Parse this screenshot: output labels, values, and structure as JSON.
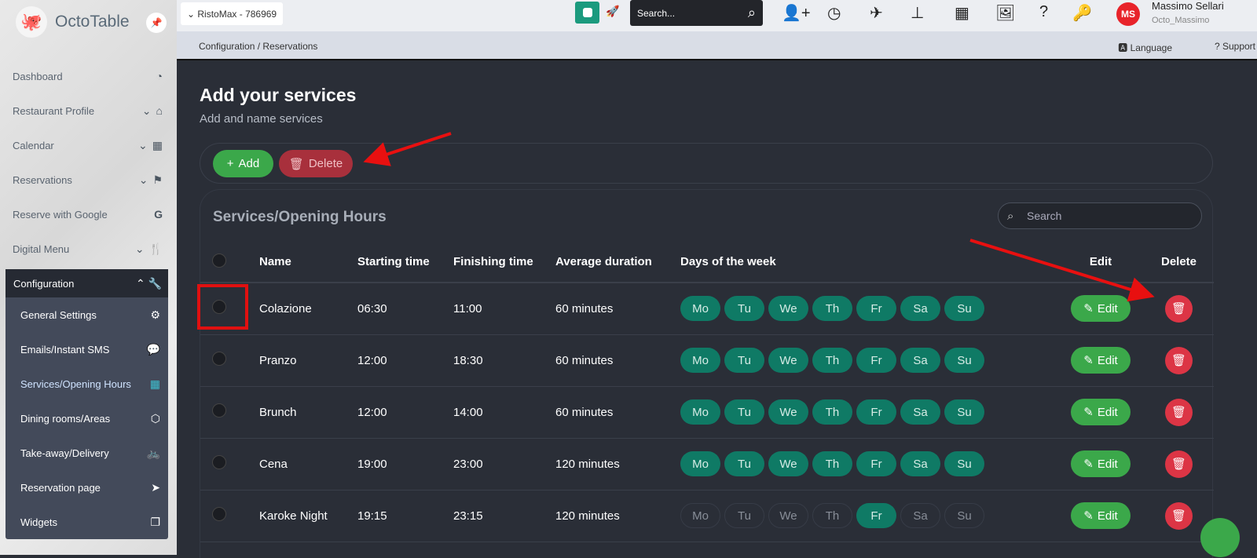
{
  "app": {
    "name": "OctoTable",
    "venue": "RistoMax - 786969"
  },
  "topbar": {
    "search_placeholder": "Search...",
    "user_initials": "MS",
    "user_name": "Massimo Sellari",
    "user_handle": "Octo_Massimo"
  },
  "breadcrumb": "Configuration / Reservations",
  "language": "Language",
  "support": "Support",
  "sidebar": {
    "items": [
      {
        "label": "Dashboard"
      },
      {
        "label": "Restaurant Profile"
      },
      {
        "label": "Calendar"
      },
      {
        "label": "Reservations"
      },
      {
        "label": "Reserve with Google"
      },
      {
        "label": "Digital Menu"
      }
    ],
    "config": {
      "label": "Configuration",
      "items": [
        {
          "label": "General Settings"
        },
        {
          "label": "Emails/Instant SMS"
        },
        {
          "label": "Services/Opening Hours"
        },
        {
          "label": "Dining rooms/Areas"
        },
        {
          "label": "Take-away/Delivery"
        },
        {
          "label": "Reservation page"
        },
        {
          "label": "Widgets"
        }
      ]
    }
  },
  "page": {
    "title": "Add your services",
    "subtitle": "Add and name services",
    "add_label": "Add",
    "delete_label": "Delete"
  },
  "table": {
    "title": "Services/Opening Hours",
    "search_placeholder": "Search",
    "headers": [
      "Name",
      "Starting time",
      "Finishing time",
      "Average duration",
      "Days of the week",
      "Edit",
      "Delete"
    ],
    "day_labels": [
      "Mo",
      "Tu",
      "We",
      "Th",
      "Fr",
      "Sa",
      "Su"
    ],
    "edit_label": "Edit",
    "rows": [
      {
        "name": "Colazione",
        "start": "06:30",
        "end": "11:00",
        "duration": "60 minutes",
        "days": [
          1,
          1,
          1,
          1,
          1,
          1,
          1
        ]
      },
      {
        "name": "Pranzo",
        "start": "12:00",
        "end": "18:30",
        "duration": "60 minutes",
        "days": [
          1,
          1,
          1,
          1,
          1,
          1,
          1
        ]
      },
      {
        "name": "Brunch",
        "start": "12:00",
        "end": "14:00",
        "duration": "60 minutes",
        "days": [
          1,
          1,
          1,
          1,
          1,
          1,
          1
        ]
      },
      {
        "name": "Cena",
        "start": "19:00",
        "end": "23:00",
        "duration": "120 minutes",
        "days": [
          1,
          1,
          1,
          1,
          1,
          1,
          1
        ]
      },
      {
        "name": "Karoke Night",
        "start": "19:15",
        "end": "23:15",
        "duration": "120 minutes",
        "days": [
          0,
          0,
          0,
          0,
          1,
          0,
          0
        ]
      }
    ]
  }
}
